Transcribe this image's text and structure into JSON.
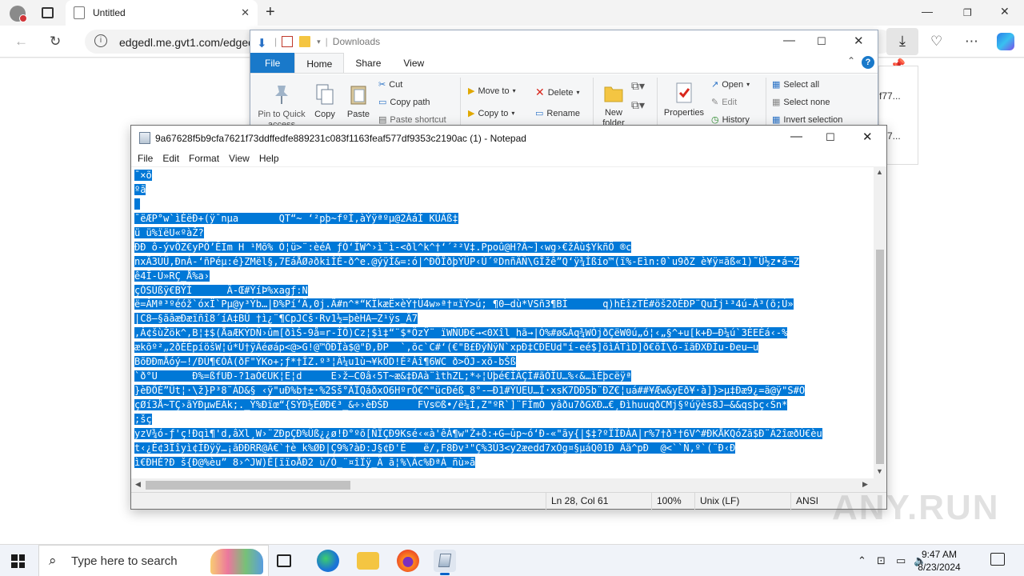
{
  "browser": {
    "tab_title": "Untitled",
    "url": "edgedl.me.gvt1.com/edgedl/",
    "accent": "#0078d7"
  },
  "downloads_flyout": {
    "items": [
      "f77...",
      "f77..."
    ]
  },
  "explorer": {
    "title": "Downloads",
    "tabs": {
      "file": "File",
      "home": "Home",
      "share": "Share",
      "view": "View"
    },
    "ribbon": {
      "pin": "Pin to Quick\naccess",
      "copy": "Copy",
      "paste": "Paste",
      "cut": "Cut",
      "copy_path": "Copy path",
      "paste_shortcut": "Paste shortcut",
      "move_to": "Move to",
      "copy_to": "Copy to",
      "delete": "Delete",
      "rename": "Rename",
      "new_folder": "New\nfolder",
      "properties": "Properties",
      "open": "Open",
      "edit": "Edit",
      "history": "History",
      "select_all": "Select all",
      "select_none": "Select none",
      "invert_selection": "Invert selection"
    },
    "help_label": "?"
  },
  "notepad": {
    "title": "9a67628f5b9cfa7621f73ddffedfe889231c083f1163feaf577df9353c2190ac (1) - Notepad",
    "menu": {
      "file": "File",
      "edit": "Edit",
      "format": "Format",
      "view": "View",
      "help": "Help"
    },
    "lines": [
      "¯×õ",
      "ºã",
      "",
      "¯ëÆP°w`ìÈëÐ+(ÿ¯nµa       QT“~ ‘²pþ~fºÍ,àÝÿªºµ@2ÂáÍ KÚÃß‡",
      "ü ü%ïëU«ºàŽ?",
      "ÐÐ ô-ývÖZ€yPÖ’ÊIm H ¹Mõ% Ô¦ü>¨:èéA ƒÓ‘ÎW^›ì¨ì-<ðl^k^†‘´²²V‡.Ppoû@H?Ã~]‹wg›€žÂù$YkñÖ ®c",
      "nxÃ3ÙÜ,ÐnÁ-‘ñPéµ:é}ZMël§,7EáÅØ∂ðkiÌÉ-ð^e.@ýÿÍ&=:ó|^ÐÕÎðþÝÜP‹Ù´ºDnñÄÑ\\GÎžê”Q‘ÿ¾Ìßío™(ï%-Eìn:0`u9ðZ è¥ÿ¤ãß«1)˜Ü½z•á¬Z",
      "ê4Î-Ù»RÇ_Å%a›",
      "çÓSÚßÿ€BÝÍ      Ä-Œ#ÝíÞ%xagƒ:N",
      "ë=ÁMª³ºéóž`óxÏ`Pµ@y³Ýb…|Ð%Pí‘Ä,0j.Ä#n^*“KÏkæË×èÝ†Ü4w»ª†¤ïÝ>ú; ¶0–dù*VSñ3¶BÌ      q)hÉîzTÉ#öš2ðÉÐP¨QuÍj¹³4ú-Ä³(õ;Ù»",
      "|C8–§ãâæÐæïñî8´íA‡BŨ †ì¿¨¶CpJCš·Rv1½=þèHA–Z¹ÿs_Ä7",
      ",Á¢šùŽök^,B¦‡$(ÅaÆKÝDÑ›ûm[ðìŠ-9å=r-ÌÕ)Cz¦$ì‡“¨$*ÖzŸ¨ ïWÑÙÐ€→<0Xîl_hã→|Ò%#ø&Áq¾WÒjðÇëW0ú„ó¦‹„§^+u[k+Ð–Ð¼ú`3ÉEÉá‹-%",
      "ækõº²„2ðÉÉpíöšW¦ú*Ú†ÿÃéøáp<@>G!@™ÔÐÏà$@\"Ð,ÐP  `,õc`C#‘(€\"B£ÐýÑÿN`xpÐ‡CÐEUd\"í-eé$]õìÃTìD]ð€õÎ\\ó-ïãÐXÐÍu-Ðeu–u",
      "BõÐÐmÅóý–!/ÐÚ¶€ÓÁ(ðF\"ÝKo+;ƒ*†ÎZ.º³¦Â¼u1ù¬¥kÔD!È²Áî¶6WC ð>ÖJ-xõ-bŠß",
      "`ð°U      Ð%=ßfUÐ-?1aÓ€UK¦E¦d     E›ž–C0â‹5T~æ&‡ÐAà¨ìthZL;*÷¦Úþé€ÍÄÇÌ#ãÒÎU…%‹&…ìÉþcëÿª",
      "}èÐÕÉ”Üt¦·\\ž}P³8¨ÁD&§ ‹ÿ\"uÐ%b†±·%2Sš°ÄÏQáðxO6HºrÕ€^\"ücÐéß_8°-—Ð1#ÝÙEU…Ï·xsK7DÐ5b¨ÐZ€¦uá##¥Æw&yEð¥·à]}>µ‡Ðæ9¿=ä@ÿ\"S#O",
      "çØí3Å~TÇ›ãÝÐµwEÀk;._Ÿ%Ðïœ“{SÝÐ½ÉØÐ€³_&÷›èÐŠÐ     FVs©ß•/ë¼Í,Z\"ºR`]¨FÌmÓ yâðu7ðGXÐ…€¸ÐìhuuqðCMj§ºúÿès8J–&&qsþç‹Šn*",
      ";šç",
      "yzV¾ó-ƒ'ç!Ðqì¶'d,âXl¸W›¨ZÐpÇÐ%Ûß¿¿ø!Ð°ºõ[ÑÏÇÐ9Ksé‹«à'êÀ¶w\"Ž+ð:+G–ûp~ó‘Ð-«\"ãy{|$‡?ºÏÍÐÀA|r%7†ð³†6V^#ÐKÅKQóZã$Ð¨Ä2îœðÙ€èu",
      "t‹¿É¢3Ïîyì¢ÍÐÿÿ…¡ãÐÐRR@Ä€`†è k%ØÐ|Ç9%?àÐ:J§¢Ð'È   ë/,F8Ðv³\"Ç%3Ù3<y2æedd7xÒg¤§µáQ01Ð Ää^pÐ  @<``Ñ,º`(¨Ð‹Ð",
      "ì€ÐHÉ?Ð š{Ð@%èu” 8›^JW)Ê[ïïoÅÐ2 ù/Ò_¨¤îÏÿ_Ä ã¦%\\Ãc%ÐªÁ_ñù»ã"
    ],
    "status": {
      "position": "Ln 28, Col 61",
      "zoom": "100%",
      "line_ending": "Unix (LF)",
      "encoding": "ANSI"
    },
    "selection_color": "#0078d7"
  },
  "watermark": "ANY.RUN",
  "taskbar": {
    "search_placeholder": "Type here to search",
    "time": "9:47 AM",
    "date": "8/23/2024"
  }
}
